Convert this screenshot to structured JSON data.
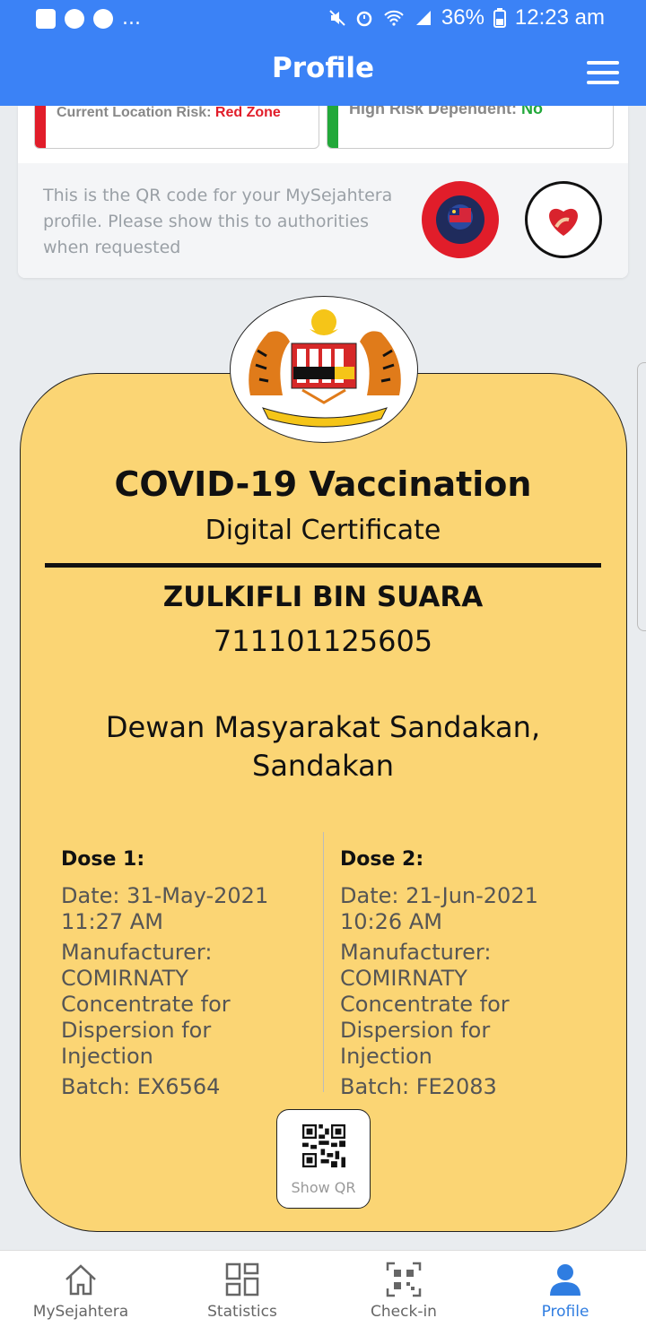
{
  "status_bar": {
    "overflow": "...",
    "battery": "36%",
    "time": "12:23 am"
  },
  "header": {
    "title": "Profile"
  },
  "top_card": {
    "current_location_risk_label": "Current Location Risk:",
    "current_location_risk_value": "Red Zone",
    "current_location_risk_color": "#e11d2a",
    "high_risk_dependent_label": "High Risk Dependent:",
    "high_risk_dependent_value": "No",
    "high_risk_dependent_color": "#22a83a",
    "qr_note": "This is the QR code for your MySejahtera profile. Please show this to authorities when requested"
  },
  "certificate": {
    "title": "COVID-19 Vaccination",
    "subtitle": "Digital Certificate",
    "holder_name": "ZULKIFLI BIN SUARA",
    "id_number": "711101125605",
    "venue": "Dewan Masyarakat Sandakan, Sandakan",
    "dose1": {
      "heading": "Dose 1:",
      "date": "Date: 31-May-2021 11:27 AM",
      "manufacturer": "Manufacturer: COMIRNATY Concentrate for Dispersion for Injection",
      "batch": "Batch: EX6564"
    },
    "dose2": {
      "heading": "Dose 2:",
      "date": "Date: 21-Jun-2021 10:26 AM",
      "manufacturer": "Manufacturer: COMIRNATY Concentrate for Dispersion for Injection",
      "batch": "Batch: FE2083"
    },
    "show_qr_label": "Show QR",
    "background_color": "#fbd574"
  },
  "bottom_nav": [
    {
      "label": "MySejahtera",
      "icon": "home-icon",
      "active": false
    },
    {
      "label": "Statistics",
      "icon": "grid-icon",
      "active": false
    },
    {
      "label": "Check-in",
      "icon": "qr-scan-icon",
      "active": false
    },
    {
      "label": "Profile",
      "icon": "user-icon",
      "active": true
    }
  ],
  "colors": {
    "brand_blue": "#3b82f6",
    "active_nav": "#2f7de1"
  }
}
